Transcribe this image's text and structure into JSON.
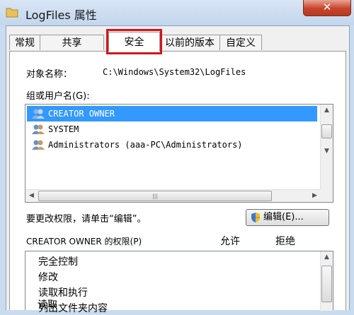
{
  "window": {
    "title": "LogFiles 属性",
    "close_label": "✕"
  },
  "tabs": [
    {
      "label": "常规"
    },
    {
      "label": "共享"
    },
    {
      "label": "安全"
    },
    {
      "label": "以前的版本"
    },
    {
      "label": "自定义"
    }
  ],
  "security": {
    "object_name_label": "对象名称：",
    "object_name_value": "C:\\Windows\\System32\\LogFiles",
    "groups_label": "组或用户名(G):",
    "users": [
      {
        "name": "CREATOR OWNER"
      },
      {
        "name": "SYSTEM"
      },
      {
        "name": "Administrators (aaa-PC\\Administrators)"
      }
    ],
    "hscroll_grip": "|||",
    "change_hint": "要更改权限，请单击“编辑”。",
    "edit_button": "编辑(E)...",
    "perm_header": "CREATOR OWNER 的权限(P)",
    "allow_header": "允许",
    "deny_header": "拒绝",
    "permissions": [
      {
        "label": "完全控制"
      },
      {
        "label": "修改"
      },
      {
        "label": "读取和执行"
      },
      {
        "label": "列出文件夹内容"
      },
      {
        "label": "读取"
      }
    ]
  }
}
